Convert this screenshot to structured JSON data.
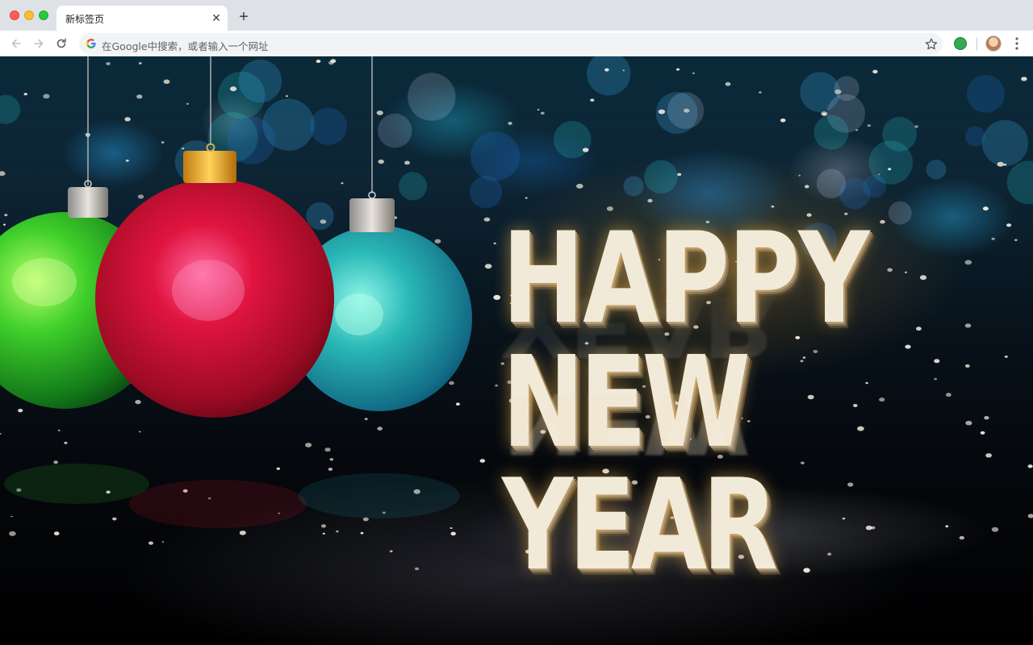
{
  "window": {
    "traffic_lights": [
      "close",
      "minimize",
      "maximize"
    ]
  },
  "tabs": [
    {
      "title": "新标签页",
      "close_icon": "close-icon"
    }
  ],
  "toolbar": {
    "back_icon": "arrow-left-icon",
    "forward_icon": "arrow-right-icon",
    "reload_icon": "reload-icon",
    "omnibox_placeholder": "在Google中搜索，或者输入一个网址",
    "bookmark_icon": "star-icon",
    "extension_icon": "extension-icon",
    "profile_icon": "avatar",
    "menu_icon": "kebab-menu-icon"
  },
  "wallpaper": {
    "headline_line1": "HAPPY",
    "headline_line2": "NEW YEAR",
    "ornaments": [
      "green-ornament",
      "red-ornament",
      "teal-ornament"
    ]
  },
  "colors": {
    "tabbar_bg": "#dee1e6",
    "omnibox_bg": "#f1f3f4",
    "ornament_green": "#2fc12a",
    "ornament_red": "#c8102e",
    "ornament_teal": "#1e8fa3",
    "headline": "#f2ead8"
  }
}
